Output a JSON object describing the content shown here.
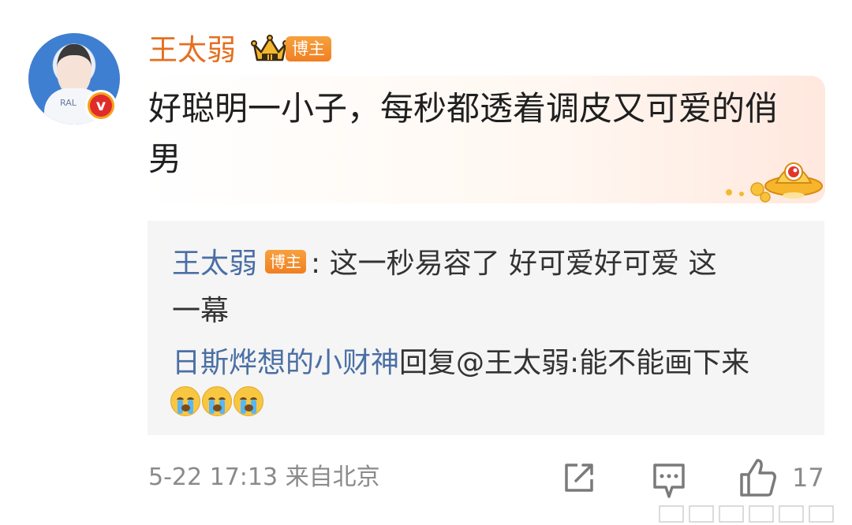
{
  "comment": {
    "user_name": "王太弱",
    "role_badge": "博主",
    "verified_icon": "v-verified-icon",
    "text": "好聪明一小子，每秒都透着调皮又可爱的俏男",
    "avatar_shirt_text": "RAL"
  },
  "quote": {
    "line1_name": "王太弱",
    "line1_badge": "博主",
    "line1_text": ": 这一秒易容了  好可爱好可爱  这",
    "line2_text": "一幕",
    "line3_name": "日斯烨想的小财神",
    "line3_text": "回复@王太弱:能不能画下来",
    "emojis": [
      "crying-face-icon",
      "crying-face-icon",
      "crying-face-icon"
    ]
  },
  "footer": {
    "time_location": "5-22 17:13  来自北京",
    "like_count": "17",
    "icons": [
      "share-icon",
      "comment-icon",
      "like-icon"
    ]
  },
  "colors": {
    "username": "#e46f20",
    "link_blue": "#4a6fa5",
    "badge_orange": "#f07f22",
    "meta_gray": "#8a8a8a"
  }
}
